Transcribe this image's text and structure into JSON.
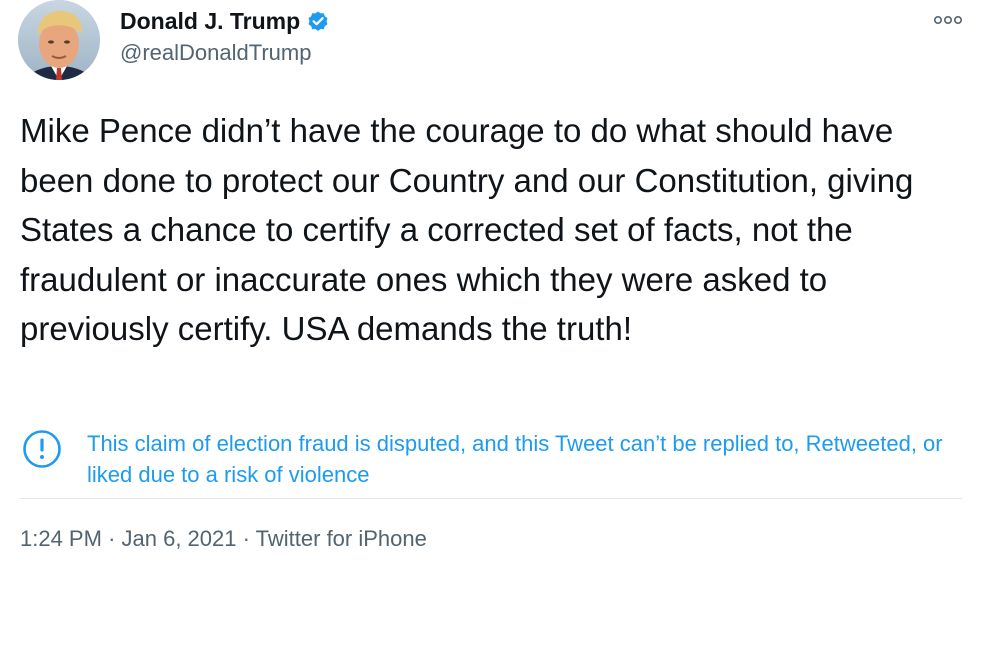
{
  "author": {
    "display_name": "Donald J. Trump",
    "handle": "@realDonaldTrump",
    "verified": true,
    "avatar_icon": "profile-photo"
  },
  "tweet": {
    "text": "Mike Pence didn’t have the courage to do what should have been done to protect our Country and our Constitution, giving States a chance to certify a corrected set of facts, not the fraudulent or inaccurate ones which they were asked to previously certify. USA demands the truth!"
  },
  "notice": {
    "icon": "exclamation-circle-icon",
    "text": "This claim of election fraud is disputed, and this Tweet can’t be replied to, Retweeted, or liked due to a risk of violence",
    "color": "#1d9bf0"
  },
  "meta": {
    "time": "1:24 PM",
    "separator": "·",
    "date": "Jan 6, 2021",
    "source": "Twitter for iPhone"
  },
  "more_icon": "ellipsis-icon",
  "colors": {
    "verified_badge": "#1d9bf0",
    "secondary_text": "#536471",
    "primary_text": "#0f1419"
  }
}
